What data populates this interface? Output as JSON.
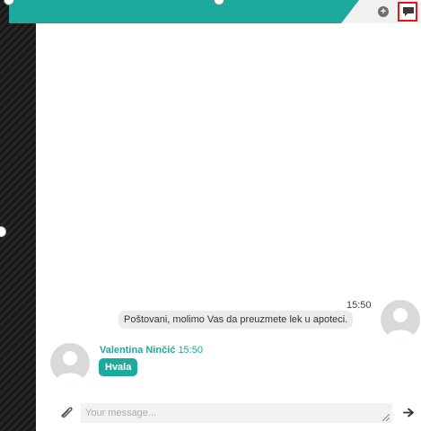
{
  "chat": {
    "messages": [
      {
        "direction": "outgoing",
        "time": "15:50",
        "text": "Poštovani, molimo Vas da preuzmete lek u apoteci."
      },
      {
        "direction": "incoming",
        "author": "Valentina Ninčić",
        "time": "15:50",
        "text": "Hvala"
      }
    ]
  },
  "composer": {
    "placeholder": "Your message..."
  },
  "icons": {
    "toolbar": [
      "add-icon",
      "chat-icon"
    ],
    "composer": [
      "paperclip-icon",
      "send-icon"
    ]
  },
  "colors": {
    "accent": "#1ea99d",
    "highlight": "#e8141c",
    "left_strip": "#1e1e1e"
  }
}
